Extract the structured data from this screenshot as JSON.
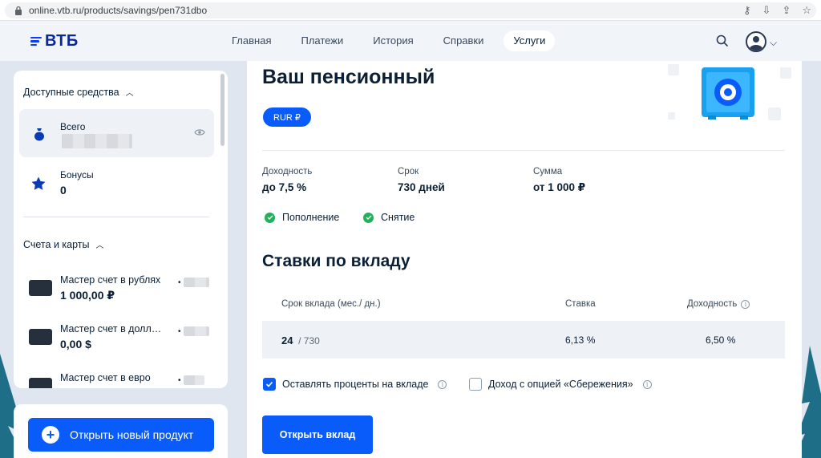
{
  "browser": {
    "url": "online.vtb.ru/products/savings/pen731dbo"
  },
  "header": {
    "logo_text": "ВТБ",
    "nav": [
      {
        "label": "Главная"
      },
      {
        "label": "Платежи"
      },
      {
        "label": "История"
      },
      {
        "label": "Справки"
      },
      {
        "label": "Услуги",
        "active": true
      }
    ]
  },
  "sidebar": {
    "available_title": "Доступные средства",
    "total_label": "Всего",
    "bonus_label": "Бонусы",
    "bonus_value": "0",
    "accounts_title": "Счета и карты",
    "accounts": [
      {
        "name": "Мастер счет в рублях",
        "value": "1 000,00 ₽"
      },
      {
        "name": "Мастер счет в долларах",
        "value": "0,00 $"
      },
      {
        "name": "Мастер счет в евро",
        "value": ""
      }
    ],
    "open_product_label": "Открыть новый продукт"
  },
  "product": {
    "title": "Ваш пенсионный",
    "currency": "RUR ₽",
    "stats": [
      {
        "key": "Доходность",
        "value": "до 7,5 %"
      },
      {
        "key": "Срок",
        "value": "730 дней"
      },
      {
        "key": "Сумма",
        "value": "от 1 000 ₽"
      }
    ],
    "features": [
      {
        "label": "Пополнение"
      },
      {
        "label": "Снятие"
      }
    ]
  },
  "rates": {
    "heading": "Ставки по вкладу",
    "col_term": "Срок вклада (мес./ дн.)",
    "col_rate": "Ставка",
    "col_yield": "Доходность",
    "row": {
      "months": "24",
      "days": "/ 730",
      "rate": "6,13 %",
      "yield": "6,50 %"
    }
  },
  "options": [
    {
      "label": "Оставлять проценты на вкладе",
      "checked": true
    },
    {
      "label": "Доход с опцией «Сбережения»",
      "checked": false
    }
  ],
  "submit_label": "Открыть вклад",
  "colors": {
    "accent": "#0a5cfa",
    "brand_dark": "#0a2896",
    "success": "#20b15a"
  }
}
